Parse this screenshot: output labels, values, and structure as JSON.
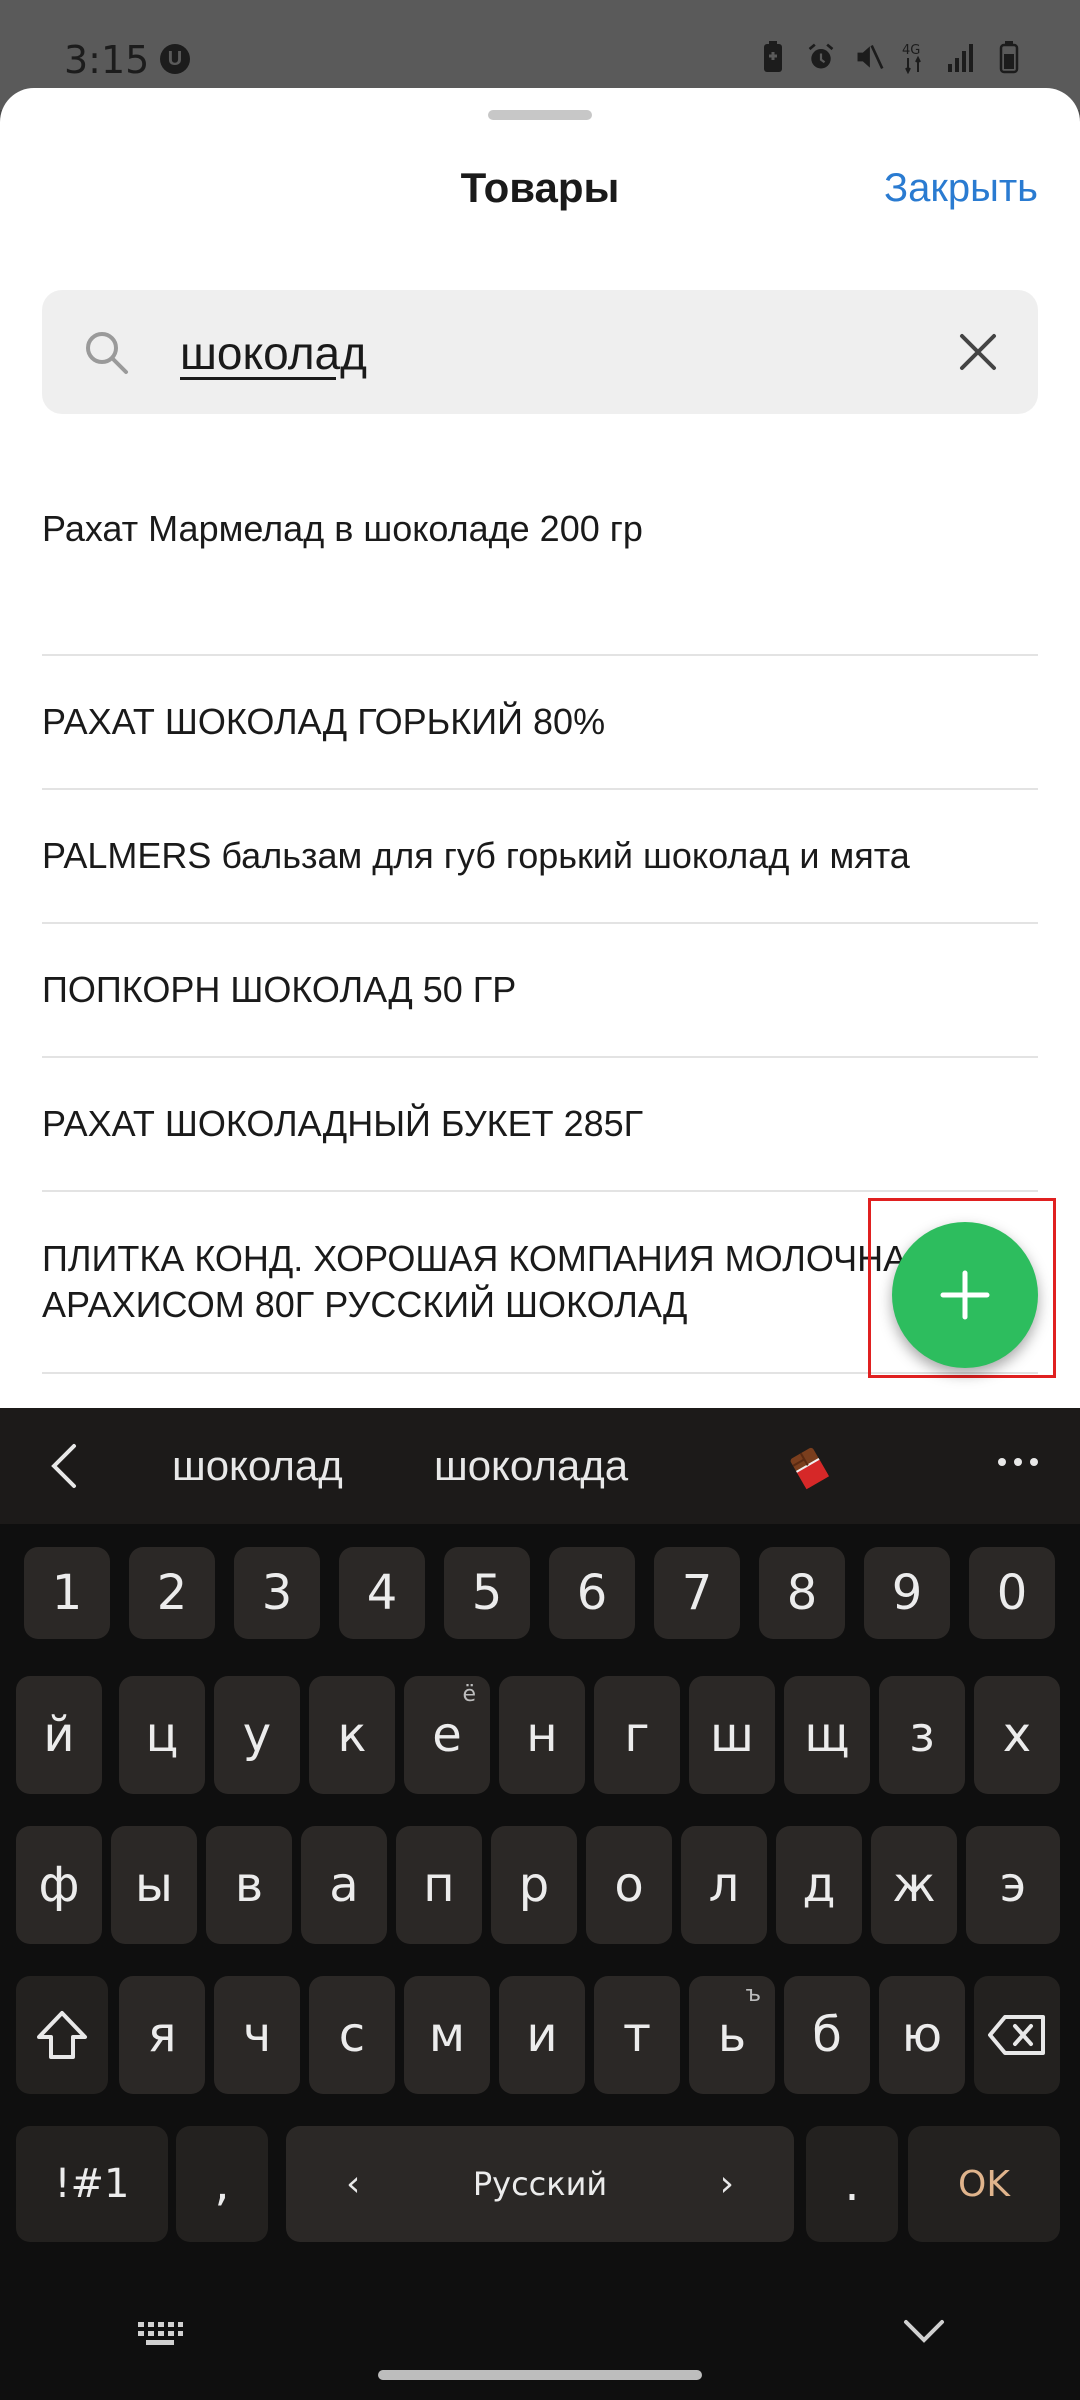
{
  "status_bar": {
    "time": "3:15",
    "u_badge": "U",
    "signal_label": "4G"
  },
  "sheet": {
    "title": "Товары",
    "close_label": "Закрыть",
    "search": {
      "value": "шоколад",
      "placeholder": ""
    },
    "items": [
      "Рахат Мармелад в шоколаде 200 гр",
      "РАХАТ ШОКОЛАД ГОРЬКИЙ 80%",
      "PALMERS бальзам для губ горький шоколад и мята",
      "ПОПКОРН ШОКОЛАД 50 ГР",
      "РАХАТ ШОКОЛАДНЫЙ БУКЕТ 285Г",
      "ПЛИТКА КОНД. ХОРОШАЯ КОМПАНИЯ МОЛОЧНАЯ С АРАХИСОМ 80Г РУССКИЙ ШОКОЛАД"
    ],
    "fab_icon": "plus-icon",
    "accent_color": "#2a7bd1",
    "fab_color": "#2dbd5e"
  },
  "keyboard": {
    "suggestions": [
      "шоколад",
      "шоколада"
    ],
    "emoji_icon": "chocolate-bar-emoji",
    "numbers": [
      "1",
      "2",
      "3",
      "4",
      "5",
      "6",
      "7",
      "8",
      "9",
      "0"
    ],
    "row1": [
      "й",
      "ц",
      "у",
      "к",
      "е",
      "н",
      "г",
      "ш",
      "щ",
      "з",
      "х"
    ],
    "row1_sup_e": "ё",
    "row2": [
      "ф",
      "ы",
      "в",
      "а",
      "п",
      "р",
      "о",
      "л",
      "д",
      "ж",
      "э"
    ],
    "row3": [
      "я",
      "ч",
      "с",
      "м",
      "и",
      "т",
      "ь",
      "б",
      "ю"
    ],
    "row3_sup_soft": "ъ",
    "symbols_label": "!#1",
    "comma": ",",
    "space_label": "Русский",
    "period": ".",
    "ok_label": "OK"
  }
}
